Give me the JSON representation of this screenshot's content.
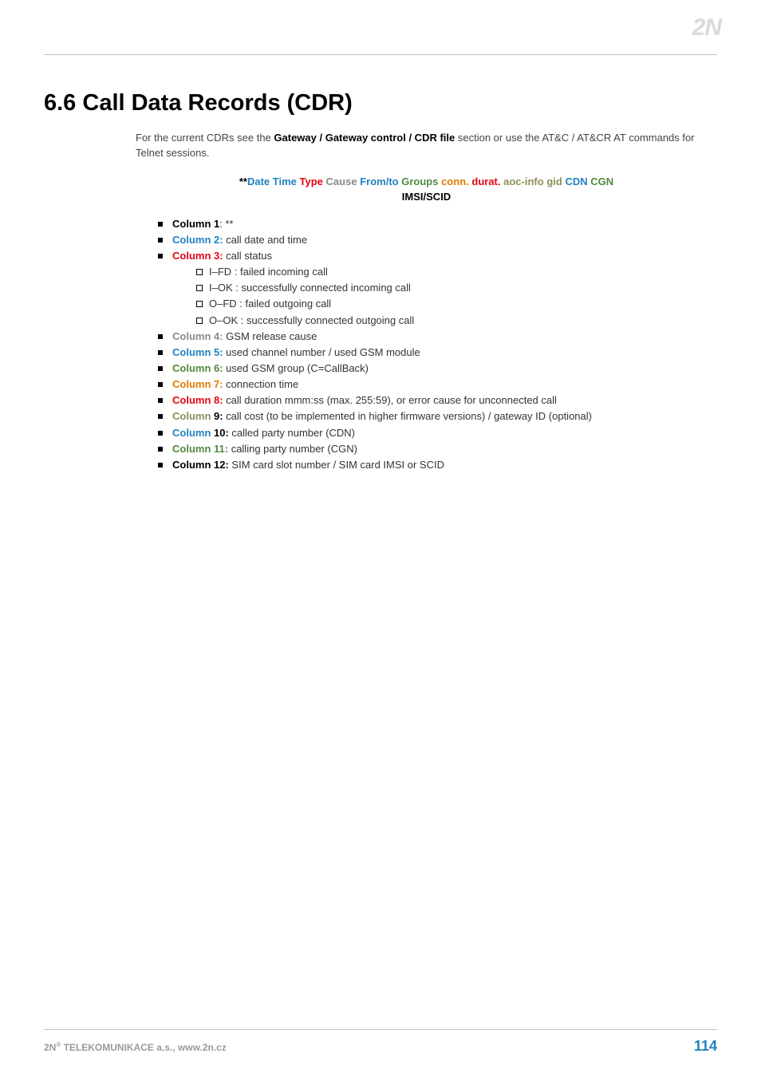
{
  "logo": "2N",
  "title": "6.6 Call Data Records (CDR)",
  "intro_pre": "For the current CDRs see the ",
  "intro_bold": "Gateway / Gateway control / CDR file",
  "intro_post": " section or use the AT&C / AT&CR AT commands for Telnet sessions.",
  "fmt": {
    "stars": "**",
    "date": "Date",
    "time": "Time",
    "type": "Type",
    "cause": "Cause",
    "fromto": "From/to",
    "groups": "Groups",
    "conn": "conn.",
    "durat": "durat.",
    "aoc": "aoc-info",
    "gid": "gid",
    "cdn": "CDN",
    "cgn": "CGN",
    "imsi": "IMSI/SCID"
  },
  "cols": {
    "c1_label": "Column 1",
    "c1_sep": ": ",
    "c1_text": "**",
    "c2_label": "Column 2:",
    "c2_text": "  call date and time",
    "c3_label": "Column 3:",
    "c3_text": "  call status",
    "c3_sub": [
      "I–FD : failed incoming call",
      "I–OK : successfully connected incoming call",
      "O–FD : failed outgoing call",
      "O–OK : successfully connected outgoing call"
    ],
    "c4_label": "Column 4:",
    "c4_text": " GSM release cause",
    "c5_label": "Column 5:",
    "c5_text": "  used channel number / used GSM module",
    "c6_label": "Column 6:",
    "c6_text": "  used GSM group (C=CallBack)",
    "c7_label": "Column 7:",
    "c7_text": "  connection time",
    "c8_label": "Column 8:",
    "c8_text": " call duration mmm:ss (max. 255:59), or error cause for unconnected call",
    "c9_label": "Column ",
    "c9_num": "9:",
    "c9_text": " call cost (to be implemented in higher firmware versions) / gateway ID (optional)",
    "c10_label": "Column ",
    "c10_num": "10:",
    "c10_text": " called party number (CDN)",
    "c11_label": "Column 11:",
    "c11_text": "  calling party number (CGN)",
    "c12_label": "Column 12:",
    "c12_text": " SIM card slot number / SIM card IMSI or SCID"
  },
  "footer": {
    "company_pre": "2N",
    "company_sup": "®",
    "company_post": " TELEKOMUNIKACE a.s., www.2n.cz",
    "page": "114"
  }
}
